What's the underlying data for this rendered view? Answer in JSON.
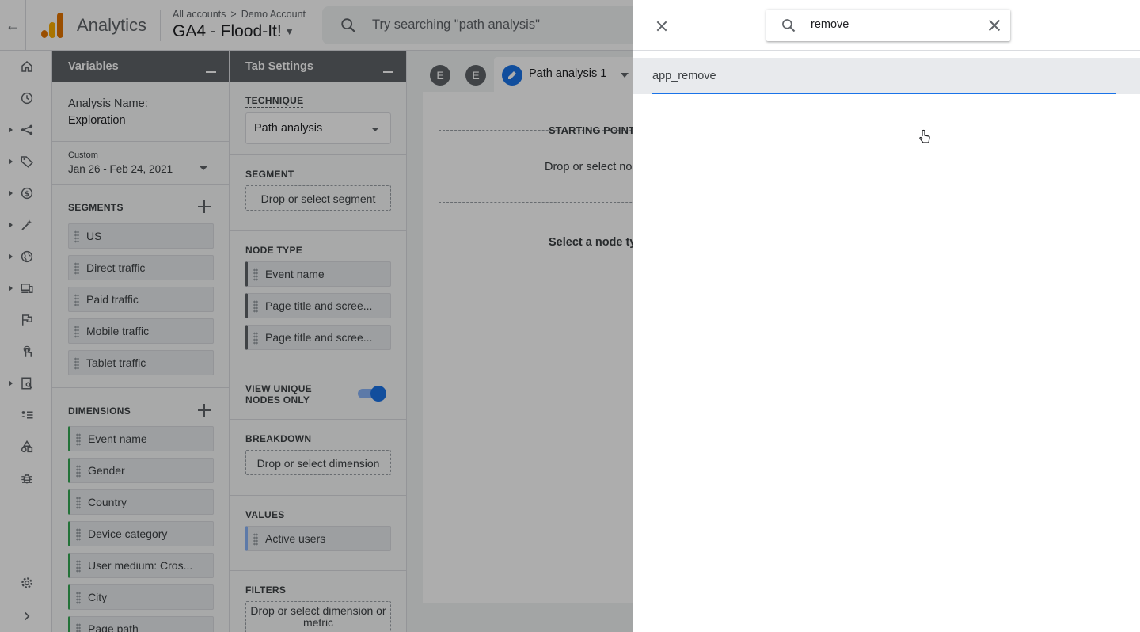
{
  "topbar": {
    "app_title": "Analytics",
    "breadcrumb_all": "All accounts",
    "breadcrumb_sep": ">",
    "breadcrumb_account": "Demo Account",
    "property": "GA4 - Flood-It!",
    "search_placeholder": "Try searching \"path analysis\""
  },
  "variables": {
    "header": "Variables",
    "analysis_name_label": "Analysis Name:",
    "analysis_name": "Exploration",
    "date_label": "Custom",
    "date_range": "Jan 26 - Feb 24, 2021",
    "segments_title": "SEGMENTS",
    "segments": [
      "US",
      "Direct traffic",
      "Paid traffic",
      "Mobile traffic",
      "Tablet traffic"
    ],
    "dimensions_title": "DIMENSIONS",
    "dimensions": [
      "Event name",
      "Gender",
      "Country",
      "Device category",
      "User medium: Cros...",
      "City",
      "Page path"
    ]
  },
  "tab_settings": {
    "header": "Tab Settings",
    "technique_title": "TECHNIQUE",
    "technique": "Path analysis",
    "segment_title": "SEGMENT",
    "segment_drop": "Drop or select segment",
    "node_type_title": "NODE TYPE",
    "node_types": [
      "Event name",
      "Page title and scree...",
      "Page title and scree..."
    ],
    "unique_nodes_label": "VIEW UNIQUE NODES ONLY",
    "unique_nodes_on": true,
    "breakdown_title": "BREAKDOWN",
    "breakdown_drop": "Drop or select dimension",
    "values_title": "VALUES",
    "values": [
      "Active users"
    ],
    "filters_title": "FILTERS",
    "filters_drop": "Drop or select dimension or metric"
  },
  "canvas": {
    "tab_e1": "E",
    "tab_e2": "E",
    "active_tab": "Path analysis 1",
    "starting_point": "STARTING POINT",
    "drop_hint": "Drop or select node",
    "node_hint": "Select a node type"
  },
  "drawer": {
    "search_value": "remove",
    "results": [
      "app_remove"
    ]
  },
  "colors": {
    "accent": "#1a73e8",
    "panel_header": "#5f6368",
    "dimension_chip": "#34a853",
    "logo_orange": "#f9ab00",
    "logo_dark_orange": "#e37400"
  }
}
